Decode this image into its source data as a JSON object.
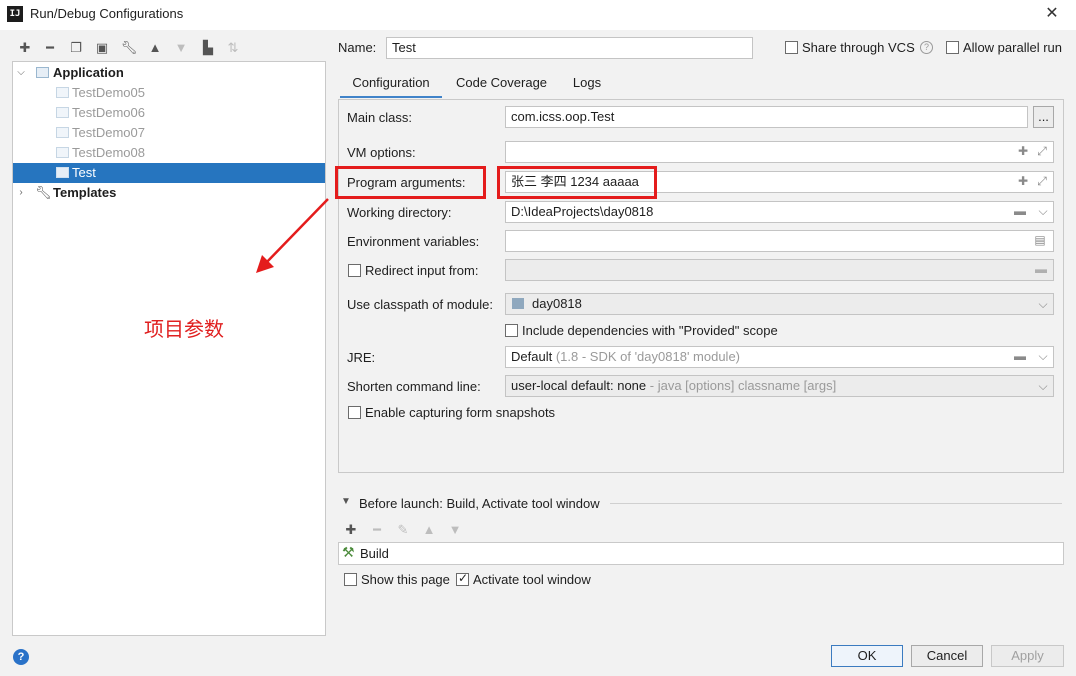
{
  "window": {
    "title": "Run/Debug Configurations",
    "app_icon_text": "IJ"
  },
  "toolbar": {
    "icons": [
      "plus-icon",
      "minus-icon",
      "copy-icon",
      "save-icon",
      "wrench-icon",
      "arrow-up-icon",
      "arrow-down-icon",
      "folder-add-icon",
      "sort-icon"
    ]
  },
  "tree": {
    "application_label": "Application",
    "items": [
      "TestDemo05",
      "TestDemo06",
      "TestDemo07",
      "TestDemo08",
      "Test"
    ],
    "templates_label": "Templates"
  },
  "annotation": {
    "text": "项目参数",
    "color": "#e02020"
  },
  "form": {
    "name_label": "Name:",
    "name_value": "Test",
    "share_label": "Share through VCS",
    "parallel_label": "Allow parallel run",
    "tabs": [
      "Configuration",
      "Code Coverage",
      "Logs"
    ],
    "main_class_label": "Main class:",
    "main_class_value": "com.icss.oop.Test",
    "browse_label": "...",
    "vm_options_label": "VM options:",
    "vm_options_value": "",
    "program_args_label": "Program arguments:",
    "program_args_value": "张三 李四 1234 aaaaa",
    "working_dir_label": "Working directory:",
    "working_dir_value": "D:\\IdeaProjects\\day0818",
    "env_vars_label": "Environment variables:",
    "env_vars_value": "",
    "redirect_label": "Redirect input from:",
    "classpath_label": "Use classpath of module:",
    "classpath_value": "day0818",
    "include_deps_label": "Include dependencies with \"Provided\" scope",
    "jre_label": "JRE:",
    "jre_value": "Default",
    "jre_hint": "(1.8 - SDK of 'day0818' module)",
    "shorten_label": "Shorten command line:",
    "shorten_value": "user-local default: none",
    "shorten_hint": "- java [options] classname [args]",
    "snapshots_label": "Enable capturing form snapshots"
  },
  "before_launch": {
    "title": "Before launch: Build, Activate tool window",
    "items": [
      "Build"
    ],
    "show_page_label": "Show this page",
    "activate_label": "Activate tool window"
  },
  "buttons": {
    "ok": "OK",
    "cancel": "Cancel",
    "apply": "Apply",
    "help": "?"
  },
  "colors": {
    "accent": "#2675bf",
    "highlight_red": "#e41c1c"
  }
}
